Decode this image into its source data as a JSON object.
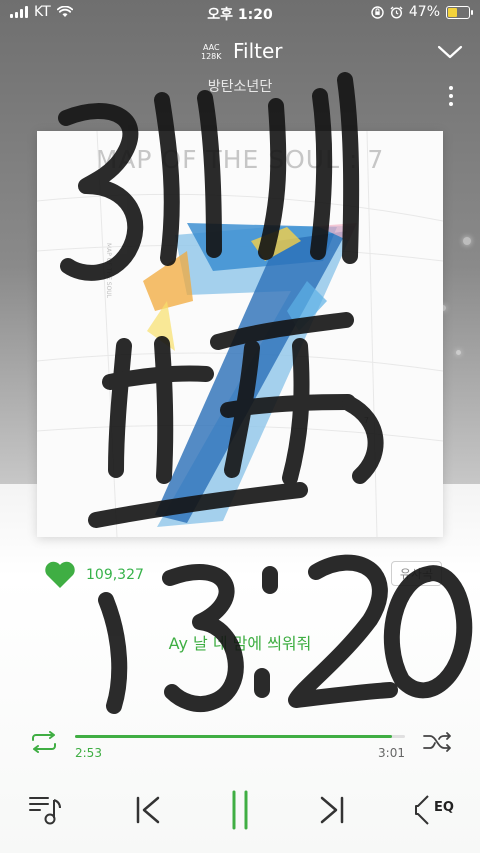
{
  "status_bar": {
    "carrier": "KT",
    "time": "오후 1:20",
    "battery": "47%",
    "battery_level": 0.47
  },
  "header": {
    "codec_line1": "AAC",
    "codec_line2": "128K",
    "song_title": "Filter",
    "artist": "방탄소년단"
  },
  "album": {
    "title": "MAP OF THE SOUL : 7",
    "side_text": "MAP OF THE SOUL",
    "corner_number": "7"
  },
  "like": {
    "count": "109,327"
  },
  "similar_button": "유사곡",
  "lyric": "Ay 날 네 맘에 씌워줘",
  "player": {
    "elapsed": "2:53",
    "total": "3:01",
    "progress": 0.96
  },
  "icons": {
    "wifi": "wifi-icon",
    "alarm": "alarm-icon",
    "lock": "orientation-lock-icon",
    "collapse": "chevron-down-icon",
    "more": "more-vert-icon",
    "heart": "heart-icon",
    "repeat": "repeat-icon",
    "shuffle": "shuffle-icon",
    "playlist": "playlist-icon",
    "prev": "skip-previous-icon",
    "pause": "pause-icon",
    "next": "skip-next-icon",
    "eq": "equalizer-icon"
  },
  "colors": {
    "accent": "#3fae43",
    "battery": "#f3d23b"
  }
}
